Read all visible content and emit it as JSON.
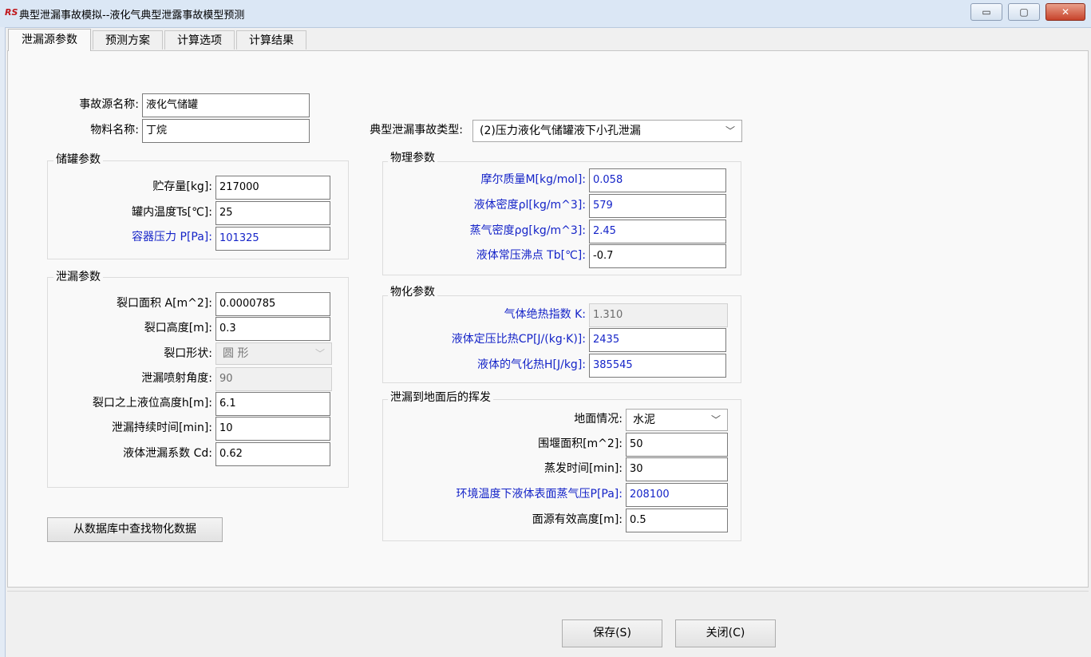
{
  "window": {
    "logo": "RS",
    "title": "典型泄漏事故模拟--液化气典型泄露事故模型预测",
    "controls": [
      "minimize-icon",
      "maximize-icon",
      "close-icon"
    ]
  },
  "tabs": [
    {
      "label": "泄漏源参数",
      "active": true
    },
    {
      "label": "预测方案"
    },
    {
      "label": "计算选项"
    },
    {
      "label": "计算结果"
    }
  ],
  "source": {
    "name_label": "事故源名称:",
    "name_value": "液化气储罐",
    "material_label": "物料名称:",
    "material_value": "丁烷",
    "accident_type_label": "典型泄漏事故类型:",
    "accident_type_value": "(2)压力液化气储罐液下小孔泄漏"
  },
  "tank": {
    "title": "储罐参数",
    "fields": [
      {
        "label": "贮存量[kg]:",
        "value": "217000"
      },
      {
        "label": "罐内温度Ts[℃]:",
        "value": "25"
      },
      {
        "label": "容器压力 P[Pa]:",
        "value": "101325"
      }
    ]
  },
  "leak": {
    "title": "泄漏参数",
    "area_label": "裂口面积 A[m^2]:",
    "area_value": "0.0000785",
    "height_label": "裂口高度[m]:",
    "height_value": "0.3",
    "shape_label": "裂口形状:",
    "shape_value": "圆 形",
    "angle_label": "泄漏喷射角度:",
    "angle_value": "90",
    "level_label": "裂口之上液位高度h[m]:",
    "level_value": "6.1",
    "duration_label": "泄漏持续时间[min]:",
    "duration_value": "10",
    "cd_label": "液体泄漏系数  Cd:",
    "cd_value": "0.62"
  },
  "physical": {
    "title": "物理参数",
    "fields": [
      {
        "label": "摩尔质量M[kg/mol]:",
        "value": "0.058"
      },
      {
        "label": "液体密度ρl[kg/m^3]:",
        "value": "579"
      },
      {
        "label": "蒸气密度ρg[kg/m^3]:",
        "value": "2.45"
      },
      {
        "label": "液体常压沸点 Tb[℃]:",
        "value": "-0.7"
      }
    ]
  },
  "physchem": {
    "title": "物化参数",
    "fields": [
      {
        "label": "气体绝热指数 K:",
        "value": "1.310"
      },
      {
        "label": "液体定压比热CP[J/(kg·K)]:",
        "value": "2435"
      },
      {
        "label": "液体的气化热H[J/kg]:",
        "value": "385545"
      }
    ]
  },
  "evap": {
    "title": "泄漏到地面后的挥发",
    "ground_label": "地面情况:",
    "ground_value": "水泥",
    "dike_label": "围堰面积[m^2]:",
    "dike_value": "50",
    "time_label": "蒸发时间[min]:",
    "time_value": "30",
    "vp_label": "环境温度下液体表面蒸气压P[Pa]:",
    "vp_value": "208100",
    "height_label": "面源有效高度[m]:",
    "height_value": "0.5"
  },
  "buttons": {
    "lookup": "从数据库中查找物化数据",
    "save": "保存(S)",
    "close": "关闭(C)"
  },
  "colors": {
    "label_blue": "#1524c8",
    "titlebar": "#dbe7f5",
    "close_red": "#c7432b"
  }
}
